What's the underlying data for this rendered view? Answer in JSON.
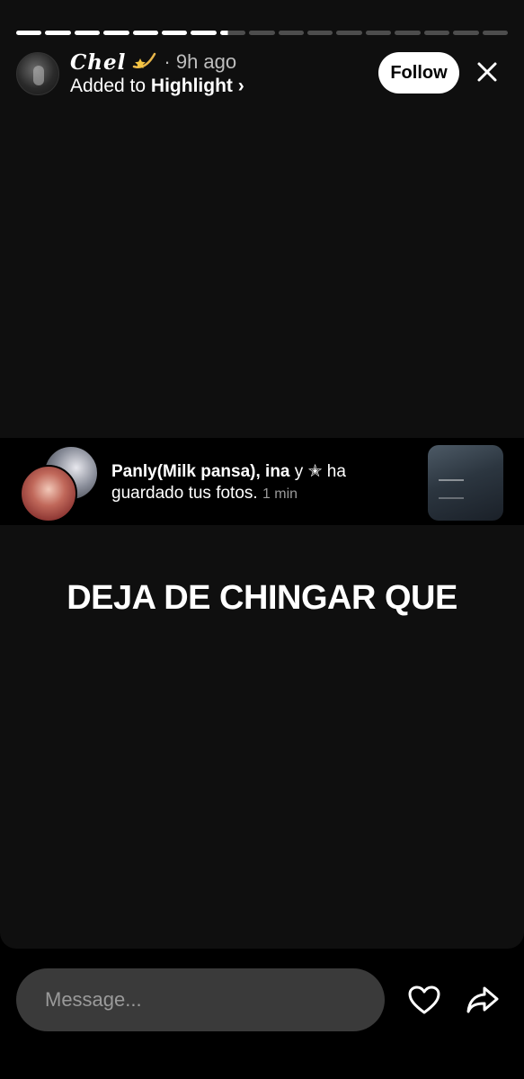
{
  "story": {
    "progress": {
      "segments": 17,
      "completed": 7,
      "current_fraction": 0.3
    },
    "username": "Chel",
    "username_icon": "shooting-star-icon",
    "time": "· 9h ago",
    "added_to_prefix": "Added to",
    "added_to_name": "Highlight",
    "chevron": "›",
    "follow_label": "Follow",
    "text": "DEJA DE CHINGAR QUE"
  },
  "notification": {
    "names": "Panly(Milk pansa), ina",
    "conjunction": "y",
    "star": "✭",
    "verb": "ha",
    "action": "guardado tus fotos.",
    "time": "1 min"
  },
  "footer": {
    "message_placeholder": "Message..."
  },
  "colors": {
    "background": "#000000",
    "card": "#0f0f0f",
    "input": "#3a3a3a",
    "muted_text": "#bdbdbd"
  }
}
